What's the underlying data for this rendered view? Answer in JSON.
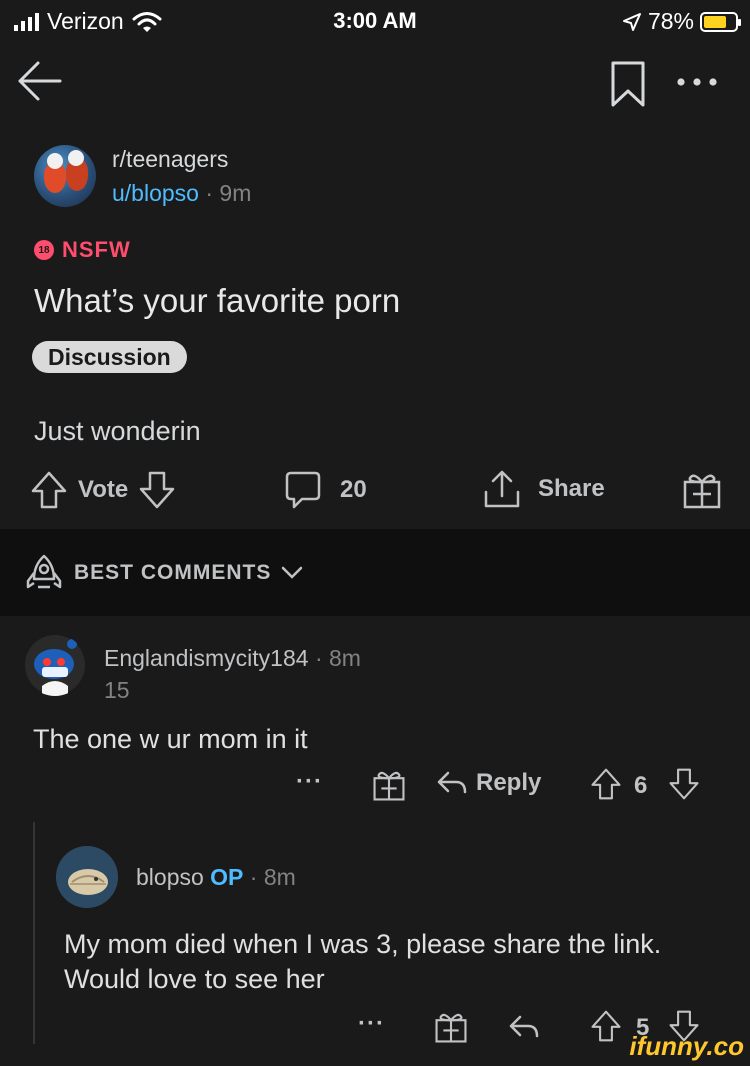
{
  "status_bar": {
    "carrier": "Verizon",
    "time": "3:00 AM",
    "battery": "78%",
    "battery_level": 0.78,
    "icons": [
      "signal-icon",
      "wifi-icon",
      "location-icon",
      "battery-icon"
    ]
  },
  "navbar": {
    "icons": [
      "back-arrow-icon",
      "bookmark-icon",
      "more-icon"
    ]
  },
  "post": {
    "subreddit": "r/teenagers",
    "author": "u/blopso",
    "separator": "·",
    "age": "9m",
    "nsfw_badge_icon_text": "18",
    "nsfw_label": "NSFW",
    "title": "What’s your favorite porn",
    "flair": "Discussion",
    "body": "Just wonderin",
    "actions": {
      "vote_label": "Vote",
      "comments_count": "20",
      "share_label": "Share"
    }
  },
  "sort": {
    "label": "BEST COMMENTS"
  },
  "comments": [
    {
      "username": "Englandismycity184",
      "age": "8m",
      "sub_score": "15",
      "text": "The one w ur mom in it",
      "more": "···",
      "reply_label": "Reply",
      "score": "6"
    },
    {
      "username": "blopso",
      "op_badge": "OP",
      "age": "8m",
      "text": "My mom died when I was 3, please share the link. Would love to see her",
      "more": "···",
      "score": "5"
    }
  ],
  "watermark": "ifunny.co",
  "colors": {
    "background": "#1a1a1b",
    "band": "#0f0f10",
    "nsfw": "#ff4d6d",
    "link": "#4fbcff",
    "battery": "#ffd21f",
    "watermark": "#ffc72c"
  }
}
